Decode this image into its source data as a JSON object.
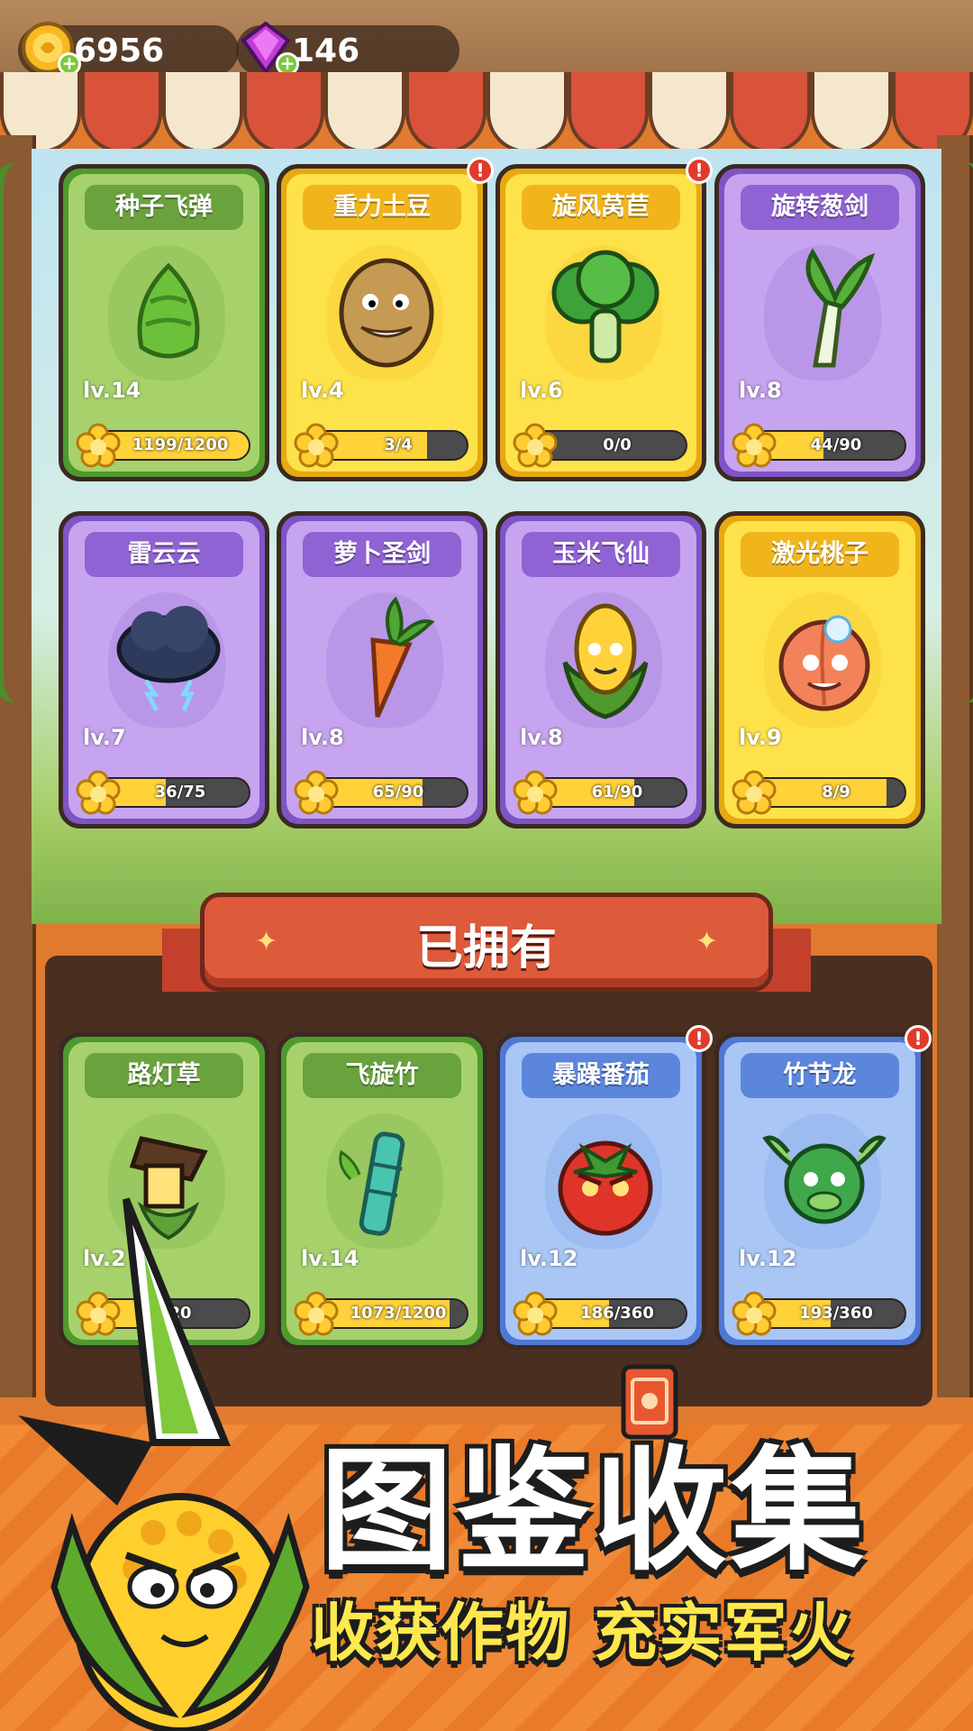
{
  "resources": {
    "coins": "6956",
    "gems": "146",
    "coin_icon": "coin-icon",
    "gem_icon": "gem-icon",
    "plus": "+"
  },
  "catalog": [
    {
      "name": "种子飞弹",
      "level": "lv.14",
      "progress": "1199/1200",
      "fraction": 0.999,
      "rarity": "green",
      "icon": "seed-missile-icon",
      "alert": false
    },
    {
      "name": "重力土豆",
      "level": "lv.4",
      "progress": "3/4",
      "fraction": 0.75,
      "rarity": "yellow",
      "icon": "potato-icon",
      "alert": true
    },
    {
      "name": "旋风莴苣",
      "level": "lv.6",
      "progress": "0/0",
      "fraction": 0,
      "rarity": "yellow",
      "icon": "lettuce-icon",
      "alert": true
    },
    {
      "name": "旋转葱剑",
      "level": "lv.8",
      "progress": "44/90",
      "fraction": 0.489,
      "rarity": "purple",
      "icon": "leek-sword-icon",
      "alert": false
    },
    {
      "name": "雷云云",
      "level": "lv.7",
      "progress": "36/75",
      "fraction": 0.48,
      "rarity": "purple",
      "icon": "thundercloud-icon",
      "alert": false
    },
    {
      "name": "萝卜圣剑",
      "level": "lv.8",
      "progress": "65/90",
      "fraction": 0.722,
      "rarity": "purple",
      "icon": "carrot-icon",
      "alert": false
    },
    {
      "name": "玉米飞仙",
      "level": "lv.8",
      "progress": "61/90",
      "fraction": 0.678,
      "rarity": "purple",
      "icon": "corn-icon",
      "alert": false
    },
    {
      "name": "激光桃子",
      "level": "lv.9",
      "progress": "8/9",
      "fraction": 0.889,
      "rarity": "yellow",
      "icon": "peach-icon",
      "alert": false
    }
  ],
  "owned_section": {
    "title": "已拥有",
    "star": "✦"
  },
  "owned": [
    {
      "name": "路灯草",
      "level": "lv.2",
      "progress": "20",
      "fraction": 0.5,
      "rarity": "green",
      "icon": "lamp-grass-icon",
      "alert": false
    },
    {
      "name": "飞旋竹",
      "level": "lv.14",
      "progress": "1073/1200",
      "fraction": 0.894,
      "rarity": "green",
      "icon": "bamboo-icon",
      "alert": false
    },
    {
      "name": "暴躁番茄",
      "level": "lv.12",
      "progress": "186/360",
      "fraction": 0.517,
      "rarity": "blue",
      "icon": "tomato-icon",
      "alert": true
    },
    {
      "name": "竹节龙",
      "level": "lv.12",
      "progress": "193/360",
      "fraction": 0.536,
      "rarity": "blue",
      "icon": "dragon-icon",
      "alert": true
    }
  ],
  "promo": {
    "title": "图鉴收集",
    "subtitle": "收获作物 充实军火"
  },
  "alert_mark": "!"
}
